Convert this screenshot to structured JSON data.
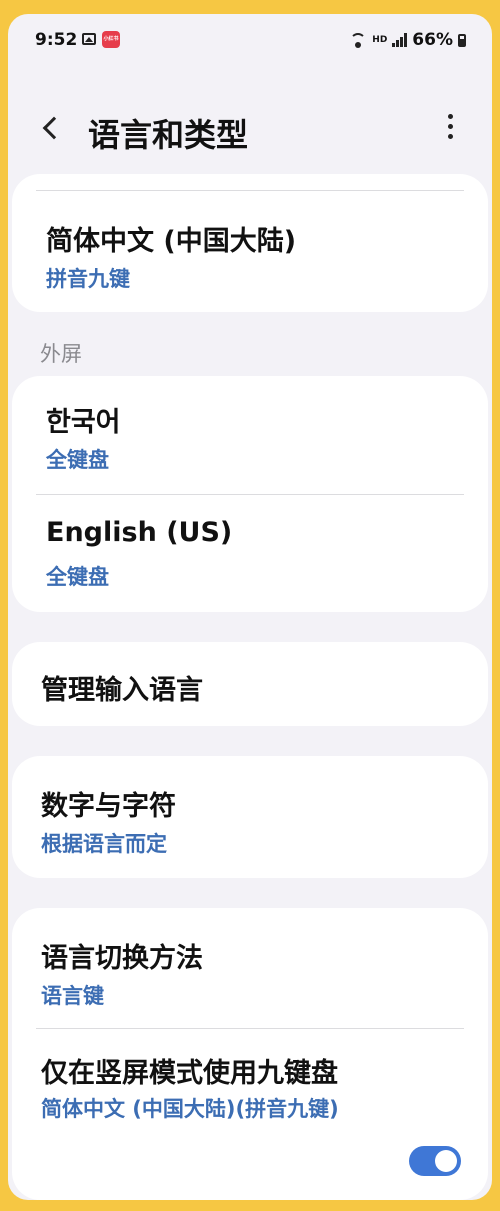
{
  "status": {
    "time": "9:52",
    "app_badge": "小红书",
    "network": "HD",
    "battery": "66%"
  },
  "header": {
    "title": "语言和类型"
  },
  "main_screen": {
    "items": [
      {
        "title": "简体中文 (中国大陆)",
        "subtitle": "拼音九键"
      }
    ]
  },
  "cover_screen": {
    "header": "外屏",
    "items": [
      {
        "title": "한국어",
        "subtitle": "全键盘"
      },
      {
        "title": "English (US)",
        "subtitle": "全键盘"
      }
    ]
  },
  "manage": {
    "title": "管理输入语言"
  },
  "numbers": {
    "title": "数字与字符",
    "subtitle": "根据语言而定"
  },
  "switching": {
    "items": [
      {
        "title": "语言切换方法",
        "subtitle": "语言键"
      },
      {
        "title": "仅在竖屏模式使用九键盘",
        "subtitle": "简体中文 (中国大陆)(拼音九键)",
        "toggle_on": true
      }
    ]
  },
  "colors": {
    "accent": "#3c6db3",
    "toggle": "#3f77d6",
    "frame": "#f6c743"
  }
}
